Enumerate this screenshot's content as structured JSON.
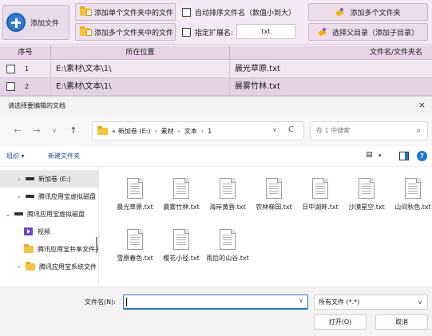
{
  "toolbar": {
    "add_files": "添加文件",
    "add_single_folder": "添加单个文件夹中的文件",
    "add_multi_folders": "添加多个文件夹中的文件",
    "auto_sort": "自动排序文件名（数值小到大）",
    "specify_ext": "指定扩展名:",
    "ext_value": "txt",
    "add_multi_files": "添加多个文件夹",
    "select_parent": "选择父目录（添加子目录）"
  },
  "table": {
    "headers": {
      "num": "序号",
      "path": "所在位置",
      "name": "文件名/文件夹名"
    },
    "rows": [
      {
        "num": "1",
        "path": "E:\\素材\\文本\\1\\",
        "name": "晨光草原.txt"
      },
      {
        "num": "2",
        "path": "E:\\素材\\文本\\1\\",
        "name": "晨雾竹林.txt"
      }
    ]
  },
  "dialog": {
    "title": "请选择要编辑的文档",
    "close": "×",
    "nav": {
      "back": "←",
      "forward": "→",
      "up_list": "∨",
      "up": "↑"
    },
    "address": {
      "prefix": "«",
      "crumbs": [
        "新加卷 (E:)",
        "素材",
        "文本",
        "1"
      ],
      "separator": "›",
      "dropdown": "∨",
      "refresh": "C"
    },
    "search_placeholder": "在 1 中搜索",
    "search_icon": "⌕",
    "commands": {
      "organize": "组织 ▾",
      "new_folder": "新建文件夹",
      "view": "▾",
      "help": "?"
    },
    "nav_pane": [
      {
        "chev": "›",
        "icon": "drive",
        "label": "新加卷 (E:)",
        "selected": true
      },
      {
        "chev": "›",
        "icon": "drive",
        "label": "腾讯应用宝虚拟磁盘"
      },
      {
        "chev": "⌄",
        "icon": "drive",
        "label": "腾讯应用宝虚拟磁盘"
      },
      {
        "chev": "",
        "icon": "video",
        "label": "视频"
      },
      {
        "chev": "",
        "icon": "folder",
        "label": "腾讯应用宝共享文件夹"
      },
      {
        "chev": "›",
        "icon": "folder",
        "label": "腾讯应用宝系统文件"
      }
    ],
    "files": [
      "晨光草原.txt",
      "晨雾竹林.txt",
      "海岸黄昏.txt",
      "农林梯田.txt",
      "日中湖畔.txt",
      "沙漠星空.txt",
      "山间秋色.txt",
      "雪原春色.txt",
      "樱花小径.txt",
      "雨后的山谷.txt"
    ],
    "filename_label": "文件名(N):",
    "filename_value": "",
    "filter": "所有文件 (*.*)",
    "open": "打开(O)",
    "cancel": "取消"
  },
  "colors": {
    "toolbar_bg": "#f4e9f4",
    "row_alt": "#e6d2e6",
    "accent_blue": "#1e77d6",
    "folder_yellow": "#f5c43b"
  }
}
